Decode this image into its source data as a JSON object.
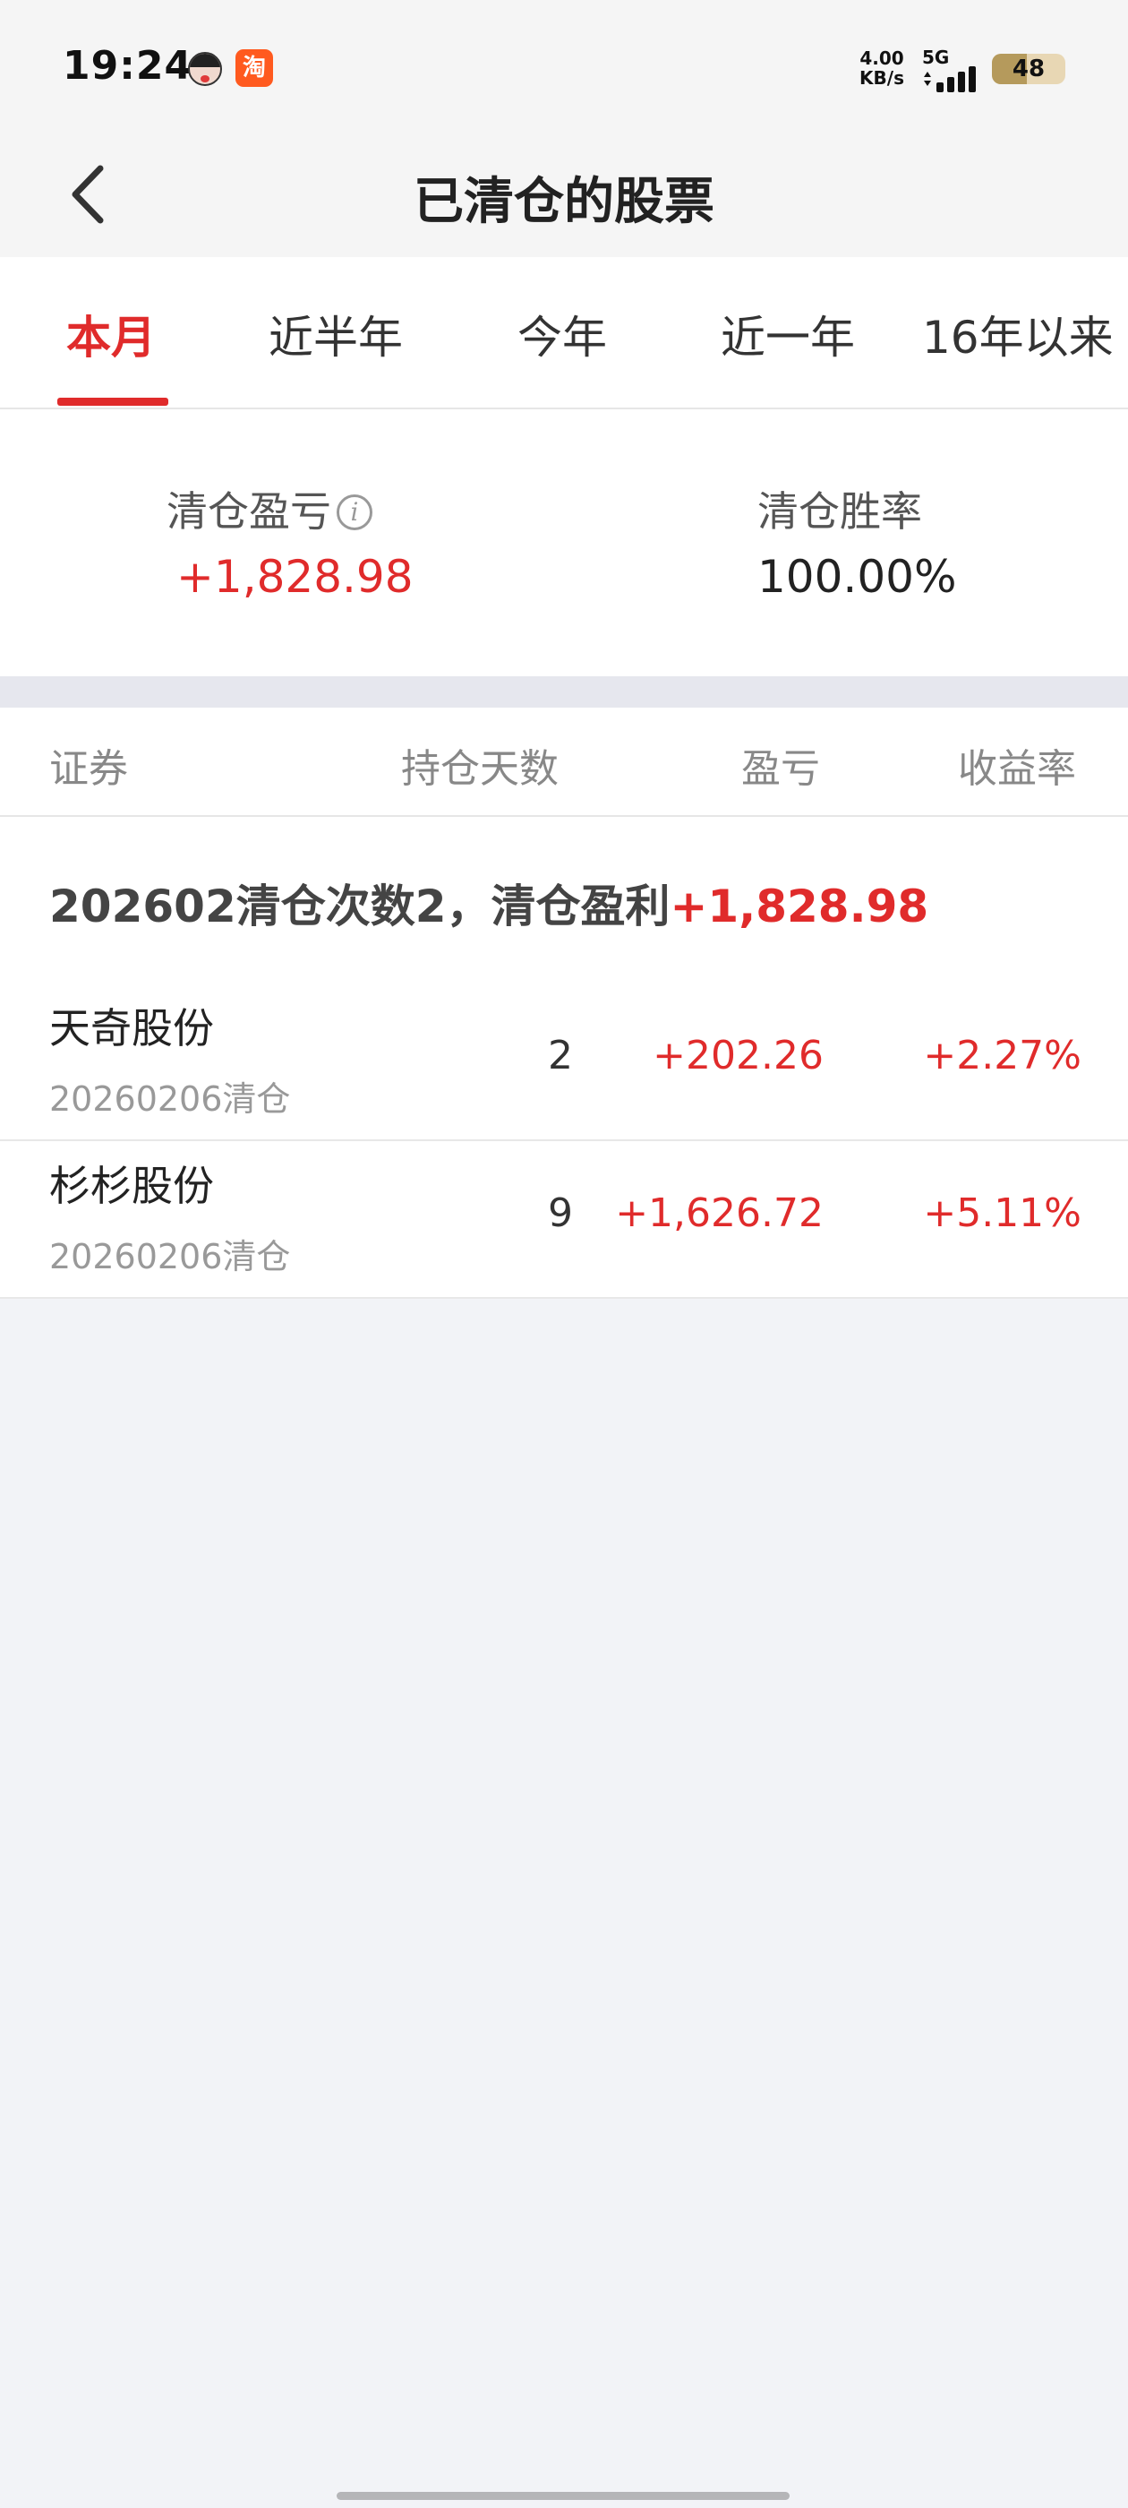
{
  "status_bar": {
    "time": "19:24",
    "network_speed_value": "4.00",
    "network_speed_unit": "KB/s",
    "network_type": "5G",
    "battery_level": "48",
    "battery_fraction": 0.48,
    "notification_icons": [
      "avatar-icon",
      "taobao-app-icon"
    ],
    "taobao_glyph": "淘"
  },
  "navbar": {
    "back_icon": "chevron-left-icon",
    "title": "已清仓的股票"
  },
  "tabs": [
    {
      "label": "本月",
      "active": true
    },
    {
      "label": "近半年",
      "active": false
    },
    {
      "label": "今年",
      "active": false
    },
    {
      "label": "近一年",
      "active": false
    },
    {
      "label": "16年以来",
      "active": false
    }
  ],
  "summary": {
    "pnl_label": "清仓盈亏",
    "pnl_info_icon": "info-icon",
    "pnl_info_glyph": "i",
    "pnl_value": "+1,828.98",
    "winrate_label": "清仓胜率",
    "winrate_value": "100.00%"
  },
  "table": {
    "columns": [
      "证券",
      "持仓天数",
      "盈亏",
      "收益率"
    ],
    "group": {
      "prefix": "202602清仓次数2，清仓盈利",
      "profit": "+1,828.98"
    },
    "rows": [
      {
        "name": "天奇股份",
        "date": "20260206清仓",
        "days": "2",
        "pnl": "+202.26",
        "rate": "+2.27%"
      },
      {
        "name": "杉杉股份",
        "date": "20260206清仓",
        "days": "9",
        "pnl": "+1,626.72",
        "rate": "+5.11%"
      }
    ]
  },
  "colors": {
    "accent": "#e02b2b",
    "background": "#f2f3f7",
    "header_bg": "#f5f5f5"
  }
}
